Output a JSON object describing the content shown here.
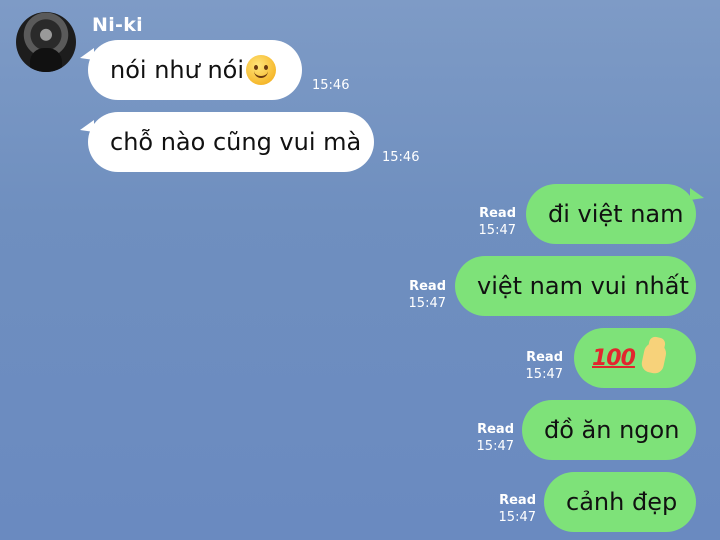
{
  "contact": {
    "name": "Ni-ki",
    "avatar_icon": "profile-avatar"
  },
  "incoming": [
    {
      "text": "nói như nói",
      "emoji": "slightly-smiling-face",
      "time": "15:46"
    },
    {
      "text": "chỗ nào cũng vui mà",
      "time": "15:46"
    }
  ],
  "outgoing": [
    {
      "text": "đi việt nam",
      "status": "Read",
      "time": "15:47"
    },
    {
      "text": "việt nam vui nhất",
      "status": "Read",
      "time": "15:47"
    },
    {
      "emoji_text": "100",
      "emoji": "waving-hand",
      "status": "Read",
      "time": "15:47"
    },
    {
      "text": "đồ ăn ngon",
      "status": "Read",
      "time": "15:47"
    },
    {
      "text": "cảnh đẹp",
      "status": "Read",
      "time": "15:47"
    }
  ],
  "colors": {
    "background": "#6f8fbf",
    "incoming_bubble": "#ffffff",
    "outgoing_bubble": "#7ee279",
    "meta_text": "#ffffff"
  }
}
